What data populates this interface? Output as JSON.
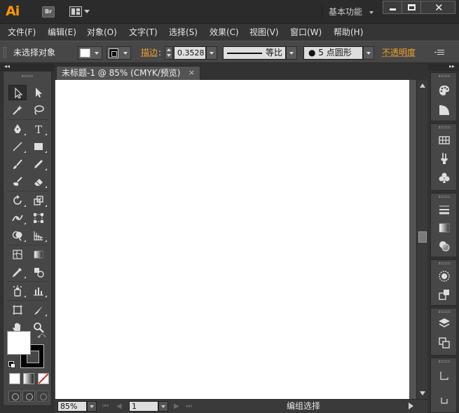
{
  "app": {
    "logo_text": "Ai",
    "bridge_label": "Br",
    "workspace": "基本功能",
    "window_controls": [
      "minimize",
      "maximize",
      "close"
    ]
  },
  "menu": {
    "items": [
      {
        "label": "文件(F)"
      },
      {
        "label": "编辑(E)"
      },
      {
        "label": "对象(O)"
      },
      {
        "label": "文字(T)"
      },
      {
        "label": "选择(S)"
      },
      {
        "label": "效果(C)"
      },
      {
        "label": "视图(V)"
      },
      {
        "label": "窗口(W)"
      },
      {
        "label": "帮助(H)"
      }
    ]
  },
  "control": {
    "selection_status": "未选择对象",
    "stroke_label": "描边",
    "stroke_weight": "0.3528",
    "profile_label": "等比",
    "brush_label": "5 点圆形",
    "opacity_label": "不透明度",
    "colors": {
      "fill": "#ffffff",
      "stroke": "#000000",
      "accent": "#f0a030"
    }
  },
  "document": {
    "tab_title": "未标题-1 @ 85% (CMYK/预览)",
    "tab_close": "×",
    "artboard_color": "#ffffff"
  },
  "status": {
    "zoom": "85%",
    "page": "1",
    "tool_status": "编组选择"
  },
  "tools": {
    "icons": [
      "selection-tool-icon",
      "direct-selection-tool-icon",
      "magic-wand-tool-icon",
      "lasso-tool-icon",
      "pen-tool-icon",
      "type-tool-icon",
      "line-segment-tool-icon",
      "rectangle-tool-icon",
      "paintbrush-tool-icon",
      "pencil-tool-icon",
      "blob-brush-tool-icon",
      "eraser-tool-icon",
      "rotate-tool-icon",
      "scale-tool-icon",
      "width-tool-icon",
      "free-transform-tool-icon",
      "shape-builder-tool-icon",
      "perspective-grid-tool-icon",
      "mesh-tool-icon",
      "gradient-tool-icon",
      "eyedropper-tool-icon",
      "blend-tool-icon",
      "symbol-sprayer-tool-icon",
      "column-graph-tool-icon",
      "artboard-tool-icon",
      "slice-tool-icon",
      "hand-tool-icon",
      "zoom-tool-icon"
    ],
    "type_glyph": "T"
  },
  "dock": {
    "icons": [
      "color-panel-icon",
      "color-guide-icon",
      "swatches-icon",
      "brushes-icon",
      "symbols-icon",
      "stroke-panel-icon",
      "gradient-panel-icon",
      "transparency-panel-icon",
      "appearance-panel-icon",
      "graphic-styles-icon",
      "layers-panel-icon",
      "artboards-panel-icon",
      "character-panel-icon",
      "paragraph-panel-icon"
    ]
  }
}
